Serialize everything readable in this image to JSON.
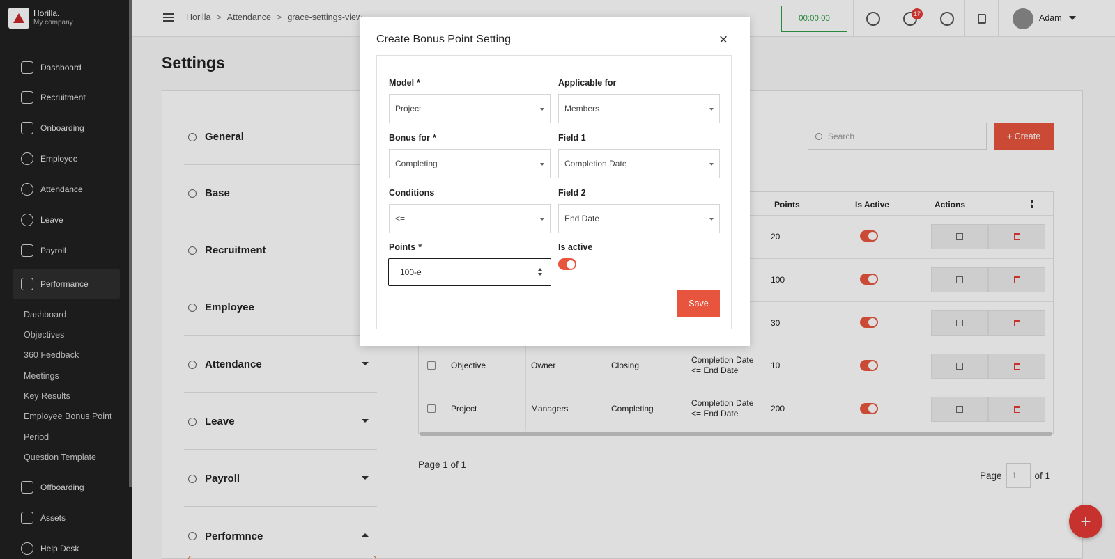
{
  "brand": {
    "name": "Horilla.",
    "company": "My company"
  },
  "sidebar": {
    "items": [
      {
        "label": "Dashboard",
        "icon": "dashboard-icon"
      },
      {
        "label": "Recruitment",
        "icon": "recruitment-icon"
      },
      {
        "label": "Onboarding",
        "icon": "rocket-icon"
      },
      {
        "label": "Employee",
        "icon": "people-icon"
      },
      {
        "label": "Attendance",
        "icon": "check-circle-icon"
      },
      {
        "label": "Leave",
        "icon": "leave-icon"
      },
      {
        "label": "Payroll",
        "icon": "wallet-icon"
      },
      {
        "label": "Performance",
        "icon": "trend-icon"
      }
    ],
    "subitems": [
      "Dashboard",
      "Objectives",
      "360 Feedback",
      "Meetings",
      "Key Results",
      "Employee Bonus Point",
      "Period",
      "Question Template"
    ],
    "bottom_items": [
      {
        "label": "Offboarding",
        "icon": "exit-icon"
      },
      {
        "label": "Assets",
        "icon": "laptop-icon"
      },
      {
        "label": "Help Desk",
        "icon": "headset-icon"
      }
    ]
  },
  "topbar": {
    "breadcrumbs": [
      "Horilla",
      "Attendance",
      "grace-settings-view"
    ],
    "timer": "00:00:00",
    "notification_count": "17",
    "user_name": "Adam"
  },
  "page": {
    "title": "Settings",
    "menu": [
      "General",
      "Base",
      "Recruitment",
      "Employee",
      "Attendance",
      "Leave",
      "Payroll",
      "Performnce"
    ],
    "search_placeholder": "Search",
    "create_label": "+ Create",
    "table_headers": [
      "Points",
      "Is Active",
      "Actions"
    ],
    "rows": [
      {
        "model": "",
        "applicable": "",
        "bonus": "",
        "condition_a": "",
        "condition_b": "",
        "points": "20"
      },
      {
        "model": "",
        "applicable": "",
        "bonus": "",
        "condition_a": "",
        "condition_b": "",
        "points": "100"
      },
      {
        "model": "",
        "applicable": "",
        "bonus": "",
        "condition_a": "",
        "condition_b": "",
        "points": "30"
      },
      {
        "model": "Objective",
        "applicable": "Owner",
        "bonus": "Closing",
        "condition_a": "Completion Date",
        "condition_b": "<= End Date",
        "points": "10"
      },
      {
        "model": "Project",
        "applicable": "Managers",
        "bonus": "Completing",
        "condition_a": "Completion Date",
        "condition_b": "<= End Date",
        "points": "200"
      }
    ],
    "pagination": {
      "summary": "Page 1 of 1",
      "label": "Page",
      "current": "1",
      "of": "of 1"
    }
  },
  "modal": {
    "title": "Create Bonus Point Setting",
    "close": "×",
    "fields": {
      "model": {
        "label": "Model",
        "required": "*",
        "value": "Project"
      },
      "applicable_for": {
        "label": "Applicable for",
        "value": "Members"
      },
      "bonus_for": {
        "label": "Bonus for",
        "required": "*",
        "value": "Completing"
      },
      "field1": {
        "label": "Field 1",
        "value": "Completion Date"
      },
      "conditions": {
        "label": "Conditions",
        "value": "<="
      },
      "field2": {
        "label": "Field 2",
        "value": "End Date"
      },
      "points": {
        "label": "Points",
        "required": "*",
        "value": "100-e"
      },
      "is_active": {
        "label": "Is active",
        "checked": true
      }
    },
    "save_label": "Save"
  },
  "colors": {
    "accent": "#e8553e",
    "sidebar_bg": "#212121",
    "timer_green": "#2e9e47"
  }
}
